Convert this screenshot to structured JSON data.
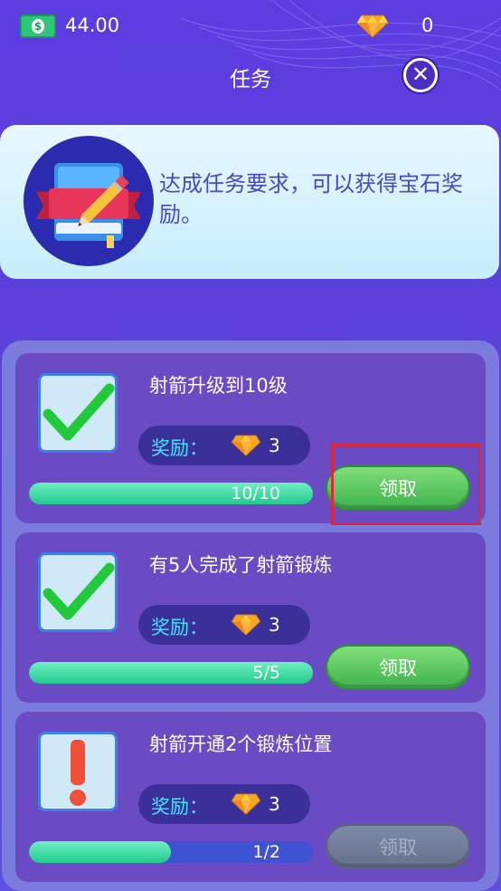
{
  "resources": {
    "money": "44.00",
    "gems": "0"
  },
  "header": {
    "title": "任务",
    "close_symbol": "✕"
  },
  "info": {
    "text": "达成任务要求，可以获得宝石奖励。"
  },
  "tasks": [
    {
      "name": "射箭升级到10级",
      "reward_label": "奖励：",
      "reward_qty": "3",
      "progress_text": "10/10",
      "progress": 1.0,
      "claim_label": "领取",
      "state": "complete",
      "icon": "checkmark-icon"
    },
    {
      "name": "有5人完成了射箭锻炼",
      "reward_label": "奖励：",
      "reward_qty": "3",
      "progress_text": "5/5",
      "progress": 1.0,
      "claim_label": "领取",
      "state": "complete",
      "icon": "checkmark-icon"
    },
    {
      "name": "射箭开通2个锻炼位置",
      "reward_label": "奖励：",
      "reward_qty": "3",
      "progress_text": "1/2",
      "progress": 0.5,
      "claim_label": "领取",
      "state": "incomplete",
      "icon": "exclamation-icon"
    }
  ],
  "colors": {
    "background": "#5a3ee0",
    "accent_cyan": "#44e4ff",
    "progress_green": "#22c98e",
    "claim_green": "#3fb24c",
    "highlight_red": "#e0263a"
  }
}
